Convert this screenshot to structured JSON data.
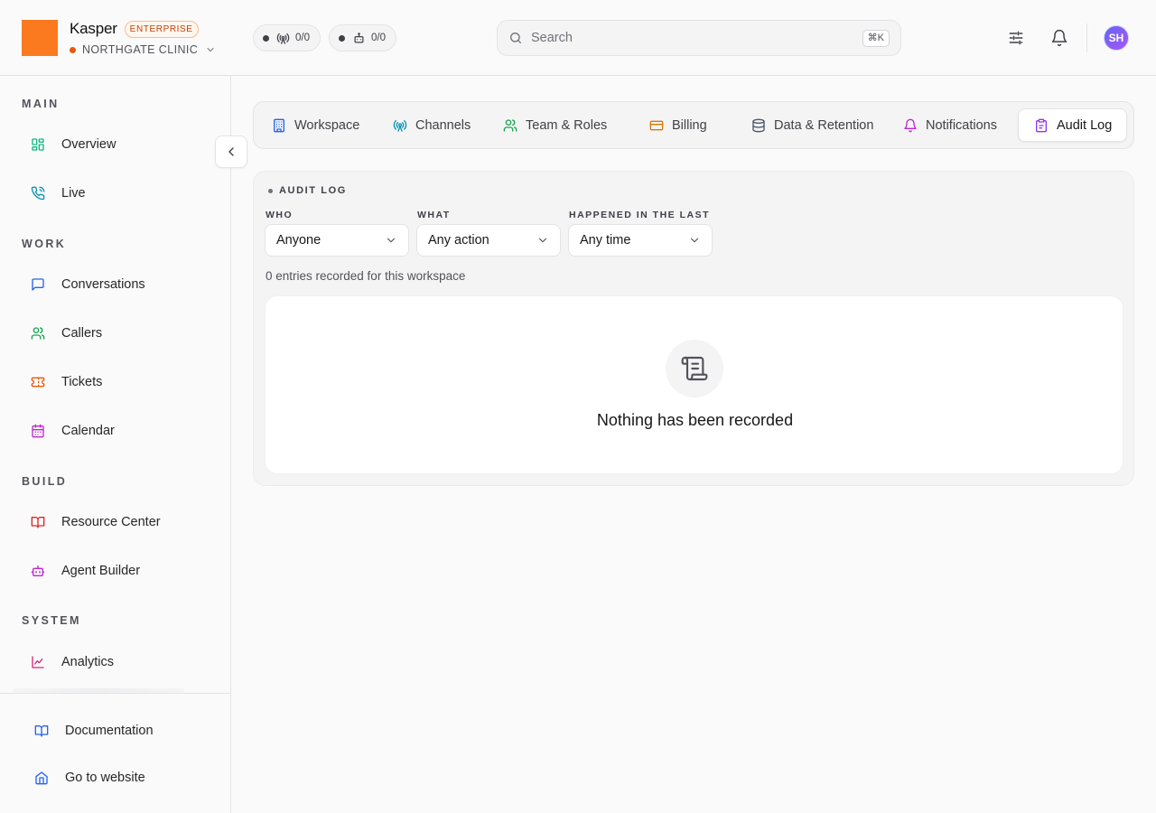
{
  "brand": {
    "name": "Kasper",
    "badge": "ENTERPRISE",
    "org": "NORTHGATE CLINIC",
    "logo_color": "#fb7a1f",
    "accent_color": "#ea580c"
  },
  "status_pills": [
    {
      "icon": "broadcast-icon",
      "value": "0/0"
    },
    {
      "icon": "robot-icon",
      "value": "0/0"
    }
  ],
  "search": {
    "placeholder": "Search",
    "shortcut": "⌘K"
  },
  "header_icons": [
    "sliders-icon",
    "bell-icon"
  ],
  "user": {
    "initials": "SH"
  },
  "sidebar": {
    "sections": [
      {
        "label": "MAIN",
        "items": [
          {
            "label": "Overview",
            "icon": "dashboard-icon",
            "color": "#10b981"
          },
          {
            "label": "Live",
            "icon": "phone-call-icon",
            "color": "#0891b2"
          }
        ]
      },
      {
        "label": "WORK",
        "items": [
          {
            "label": "Conversations",
            "icon": "chat-icon",
            "color": "#2563eb"
          },
          {
            "label": "Callers",
            "icon": "users-icon",
            "color": "#16a34a"
          },
          {
            "label": "Tickets",
            "icon": "ticket-icon",
            "color": "#ea580c"
          },
          {
            "label": "Calendar",
            "icon": "calendar-icon",
            "color": "#c026d3"
          }
        ]
      },
      {
        "label": "BUILD",
        "items": [
          {
            "label": "Resource Center",
            "icon": "book-open-icon",
            "color": "#dc2626"
          },
          {
            "label": "Agent Builder",
            "icon": "bot-icon",
            "color": "#c026d3"
          }
        ]
      },
      {
        "label": "SYSTEM",
        "items": [
          {
            "label": "Analytics",
            "icon": "line-chart-icon",
            "color": "#db2777"
          }
        ]
      }
    ],
    "footer": [
      {
        "label": "Documentation",
        "icon": "book-icon",
        "color": "#2563eb"
      },
      {
        "label": "Go to website",
        "icon": "home-icon",
        "color": "#2563eb"
      }
    ]
  },
  "tabs": [
    {
      "label": "Workspace",
      "icon": "building-icon",
      "color": "#2563eb",
      "active": false
    },
    {
      "label": "Channels",
      "icon": "antenna-icon",
      "color": "#0891b2",
      "active": false
    },
    {
      "label": "Team & Roles",
      "icon": "users-icon",
      "color": "#16a34a",
      "active": false
    },
    {
      "label": "Billing",
      "icon": "credit-card-icon",
      "color": "#d97706",
      "active": false
    },
    {
      "label": "Data & Retention",
      "icon": "database-icon",
      "color": "#475569",
      "active": false
    },
    {
      "label": "Notifications",
      "icon": "bell-icon",
      "color": "#c026d3",
      "active": false
    },
    {
      "label": "Audit Log",
      "icon": "clipboard-icon",
      "color": "#9333ea",
      "active": true
    }
  ],
  "audit": {
    "title": "AUDIT LOG",
    "filters": [
      {
        "label": "WHO",
        "value": "Anyone"
      },
      {
        "label": "WHAT",
        "value": "Any action"
      },
      {
        "label": "HAPPENED IN THE LAST",
        "value": "Any time"
      }
    ],
    "entries_text": "0 entries recorded for this workspace",
    "empty_text": "Nothing has been recorded",
    "empty_icon": "scroll-icon"
  }
}
